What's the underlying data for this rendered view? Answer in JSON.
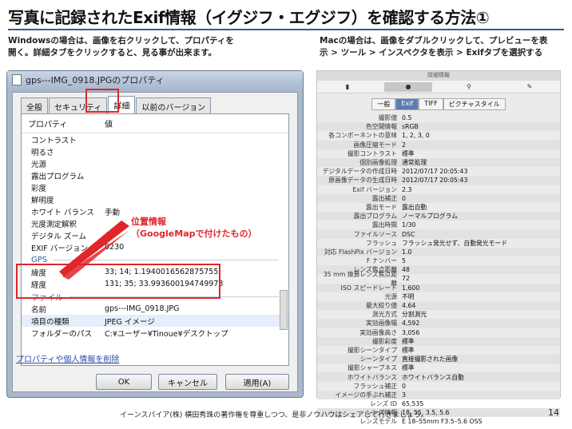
{
  "title": "写真に記録されたExif情報（イグジフ・エグジフ）を確認する方法①",
  "desc_windows": [
    "Windowsの場合は、画像を右クリックして、プロパティを",
    "開く。詳細タブをクリックすると、見る事が出来ます。"
  ],
  "desc_mac": [
    "Macの場合は、画像をダブルクリックして、プレビューを表",
    "示 > ツール > インスペクタを表示 > Exifタブを選択する"
  ],
  "win": {
    "title": "gps---IMG_0918.JPGのプロパティ",
    "tabs": [
      "全般",
      "セキュリティ",
      "詳細",
      "以前のバージョン"
    ],
    "head_prop": "プロパティ",
    "head_val": "値",
    "rows_top": [
      {
        "k": "コントラスト",
        "v": ""
      },
      {
        "k": "明るさ",
        "v": ""
      },
      {
        "k": "光源",
        "v": ""
      },
      {
        "k": "露出プログラム",
        "v": ""
      },
      {
        "k": "彩度",
        "v": ""
      },
      {
        "k": "鮮明度",
        "v": ""
      },
      {
        "k": "ホワイト バランス",
        "v": "手動"
      },
      {
        "k": "光度測定解釈",
        "v": ""
      },
      {
        "k": "デジタル ズーム",
        "v": "4"
      },
      {
        "k": "EXIF バージョン",
        "v": "0230"
      }
    ],
    "section_gps": "GPS",
    "rows_gps": [
      {
        "k": "緯度",
        "v": "33; 14; 1.1940016562875755"
      },
      {
        "k": "経度",
        "v": "131; 35; 33.993600194749973"
      }
    ],
    "section_file": "ファイル",
    "rows_file": [
      {
        "k": "名前",
        "v": "gps---IMG_0918.JPG"
      },
      {
        "k": "項目の種類",
        "v": "JPEG イメージ"
      },
      {
        "k": "フォルダーのパス",
        "v": "C:¥ユーザー¥Tinoue¥デスクトップ"
      }
    ],
    "link": "プロパティや個人情報を削除",
    "ok": "OK",
    "cancel": "キャンセル",
    "apply": "適用(A)",
    "callout": [
      "位置情報",
      "（GoogleMapで付けたもの）"
    ]
  },
  "mac": {
    "title": "詳細情報",
    "tabs": [
      "一般",
      "Exif",
      "TIFF",
      "ピクチャスタイル"
    ],
    "toolbar": [
      "document-icon",
      "info-icon",
      "search-icon",
      "pencil-icon"
    ],
    "rows": [
      {
        "k": "撮影値",
        "v": "0.5"
      },
      {
        "k": "色空間情報",
        "v": "sRGB"
      },
      {
        "k": "各コンポーネントの意味",
        "v": "1, 2, 3, 0"
      },
      {
        "k": "画像圧縮モード",
        "v": "2"
      },
      {
        "k": "撮影コントラスト",
        "v": "標準"
      },
      {
        "k": "個別画像処理",
        "v": "通常処理"
      },
      {
        "k": "デジタルデータの作成日時",
        "v": "2012/07/17 20:05:43"
      },
      {
        "k": "原画像データの生成日時",
        "v": "2012/07/17 20:05:43"
      },
      {
        "k": "Exif バージョン",
        "v": "2.3"
      },
      {
        "k": "露出補正",
        "v": "0"
      },
      {
        "k": "露出モード",
        "v": "露出自動"
      },
      {
        "k": "露出プログラム",
        "v": "ノーマルプログラム"
      },
      {
        "k": "露出時間",
        "v": "1/30"
      },
      {
        "k": "ファイルソース",
        "v": "DSC"
      },
      {
        "k": "フラッシュ",
        "v": "フラッシュ発光せず、自動発光モード"
      },
      {
        "k": "対応 FlashPix バージョン",
        "v": "1.0"
      },
      {
        "k": "F ナンバー",
        "v": "5"
      },
      {
        "k": "レンズ焦点距離",
        "v": "48"
      },
      {
        "k": "35 mm 換算レンズ焦点距離",
        "v": "72"
      },
      {
        "k": "ISO スピードレート",
        "v": "1,600"
      },
      {
        "k": "光源",
        "v": "不明"
      },
      {
        "k": "最大絞り値",
        "v": "4.64"
      },
      {
        "k": "測光方式",
        "v": "分割測光"
      },
      {
        "k": "実効画像幅",
        "v": "4,592"
      },
      {
        "k": "実効画像高さ",
        "v": "3,056"
      },
      {
        "k": "撮影彩度",
        "v": "標準"
      },
      {
        "k": "撮影シーンタイプ",
        "v": "標準"
      },
      {
        "k": "シーンタイプ",
        "v": "直接撮影された画像"
      },
      {
        "k": "撮影シャープネス",
        "v": "標準"
      },
      {
        "k": "ホワイトバランス",
        "v": "ホワイトバランス自動"
      },
      {
        "k": "フラッシュ補正",
        "v": "0"
      },
      {
        "k": "イメージの手ぶれ補正",
        "v": "3"
      },
      {
        "k": "レンズ ID",
        "v": "65,535"
      },
      {
        "k": "レンズ情報",
        "v": "18, 55, 3.5, 5.6"
      },
      {
        "k": "レンズモデル",
        "v": "E 18–55mm F3.5–5.6 OSS"
      }
    ]
  },
  "footer": "イーンスパイア(株) 横田秀珠の著作権を尊重しつつ、是非ノウハウはシェアして行きましょう。",
  "page_number": "14"
}
